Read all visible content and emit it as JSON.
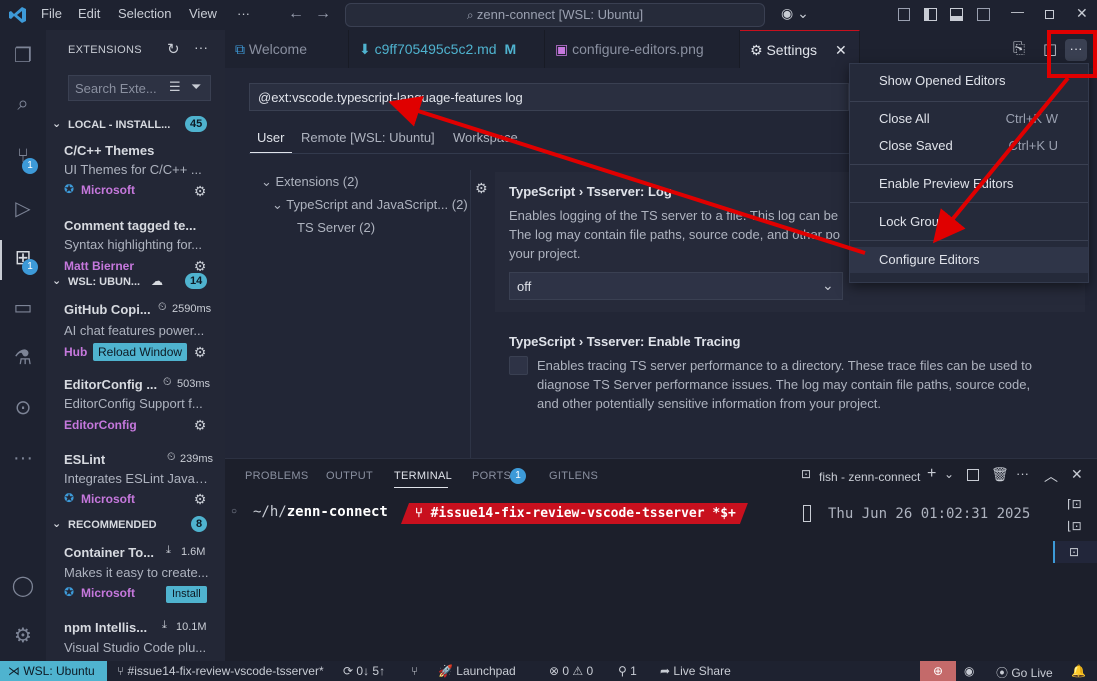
{
  "titlebar": {
    "menu": [
      "File",
      "Edit",
      "Selection",
      "View",
      "···"
    ],
    "command_center": "zenn-connect [WSL: Ubuntu]"
  },
  "activity": {
    "scm_badge": "1",
    "extensions_badge": "1"
  },
  "sidebar": {
    "title": "EXTENSIONS",
    "search_placeholder": "Search Exte...",
    "sections": [
      {
        "label": "LOCAL - INSTALL...",
        "count": "45"
      },
      {
        "label": "WSL: UBUN...",
        "count": "14"
      },
      {
        "label": "RECOMMENDED",
        "count": "8"
      }
    ],
    "local": [
      {
        "name": "C/C++ Themes",
        "desc": "UI Themes for C/C++ ...",
        "publisher": "Microsoft"
      },
      {
        "name": "Comment tagged te...",
        "desc": "Syntax highlighting for...",
        "publisher": "Matt Bierner"
      }
    ],
    "wsl": [
      {
        "name": "GitHub Copi...",
        "time": "2590ms",
        "desc": "AI chat features power...",
        "publisher": "Hub",
        "action": "Reload Window"
      },
      {
        "name": "EditorConfig ...",
        "time": "503ms",
        "desc": "EditorConfig Support f...",
        "publisher": "EditorConfig"
      },
      {
        "name": "ESLint",
        "time": "239ms",
        "desc": "Integrates ESLint JavaS...",
        "publisher": "Microsoft"
      }
    ],
    "recommended": [
      {
        "name": "Container To...",
        "downloads": "1.6M",
        "desc": "Makes it easy to create...",
        "publisher": "Microsoft",
        "action": "Install"
      },
      {
        "name": "npm Intellis...",
        "downloads": "10.1M",
        "desc": "Visual Studio Code plu..."
      }
    ]
  },
  "tabs": [
    {
      "label": "Welcome"
    },
    {
      "label": "c9ff705495c5c2.md",
      "badge": "M"
    },
    {
      "label": "configure-editors.png"
    },
    {
      "label": "Settings"
    }
  ],
  "settings": {
    "search_value": "@ext:vscode.typescript-language-features log",
    "scopes": [
      "User",
      "Remote [WSL: Ubuntu]",
      "Workspace"
    ],
    "tree": [
      {
        "label": "Extensions",
        "count": "(2)"
      },
      {
        "label": "TypeScript and JavaScript...",
        "count": "(2)"
      },
      {
        "label": "TS Server",
        "count": "(2)"
      }
    ],
    "log": {
      "title_prefix": "TypeScript › ",
      "title": "Tsserver: Log",
      "desc1": "Enables logging of the TS server to a file. This log can be",
      "desc2": "The log may contain file paths, source code, and other po",
      "desc3": "your project.",
      "value": "off"
    },
    "tracing": {
      "title_prefix": "TypeScript › ",
      "title": "Tsserver: Enable Tracing",
      "desc1": "Enables tracing TS server performance to a directory. These trace files can be used to",
      "desc2": "diagnose TS Server performance issues. The log may contain file paths, source code,",
      "desc3": "and other potentially sensitive information from your project."
    }
  },
  "context_menu": {
    "items": [
      {
        "label": "Show Opened Editors",
        "key": ""
      },
      {
        "label": "Close All",
        "key": "Ctrl+K W"
      },
      {
        "label": "Close Saved",
        "key": "Ctrl+K U"
      },
      {
        "label": "Enable Preview Editors",
        "key": ""
      },
      {
        "label": "Lock Group",
        "key": ""
      },
      {
        "label": "Configure Editors",
        "key": ""
      }
    ]
  },
  "panel": {
    "tabs": [
      "PROBLEMS",
      "OUTPUT",
      "TERMINAL",
      "PORTS",
      "GITLENS"
    ],
    "ports_badge": "1",
    "terminal_name": "fish - zenn-connect",
    "prompt_path_prefix": "~/h/",
    "prompt_path_dir": "zenn-connect",
    "prompt_branch": "#issue14-fix-review-vscode-tsserver *$+",
    "prompt_time": "Thu Jun 26 01:02:31 2025"
  },
  "statusbar": {
    "remote": "WSL: Ubuntu",
    "branch": "#issue14-fix-review-vscode-tsserver*",
    "sync": "0↓ 5↑",
    "launchpad": "Launchpad",
    "errors": "0",
    "warnings": "0",
    "ports": "1",
    "liveshare": "Live Share",
    "golive": "Go Live"
  },
  "colors": {
    "annotation_red": "#e00000",
    "accent_blue": "#3d9ad8",
    "badge_teal": "#4fb3cf",
    "remote_bg": "#4fb3cf",
    "prompt_red": "#c8101e"
  }
}
